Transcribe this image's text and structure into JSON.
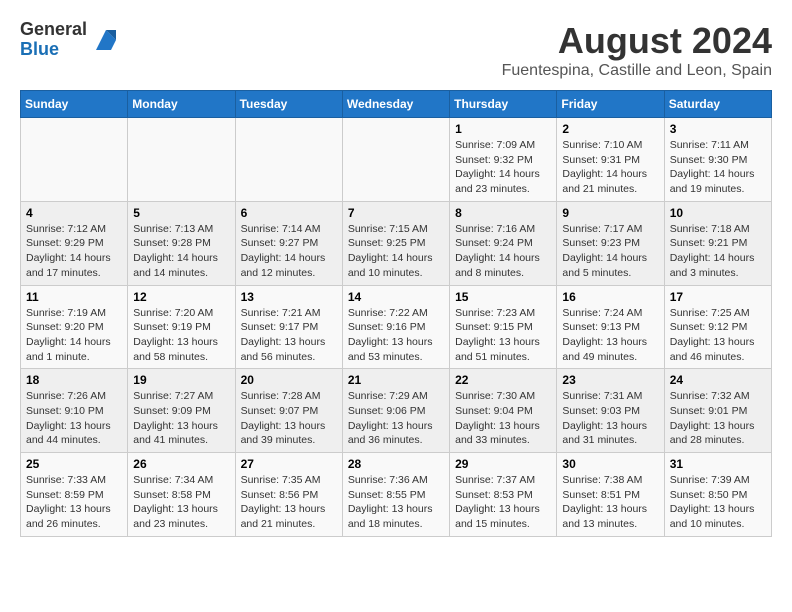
{
  "header": {
    "logo_general": "General",
    "logo_blue": "Blue",
    "month_year": "August 2024",
    "location": "Fuentespina, Castille and Leon, Spain"
  },
  "weekdays": [
    "Sunday",
    "Monday",
    "Tuesday",
    "Wednesday",
    "Thursday",
    "Friday",
    "Saturday"
  ],
  "weeks": [
    [
      {
        "day": "",
        "info": ""
      },
      {
        "day": "",
        "info": ""
      },
      {
        "day": "",
        "info": ""
      },
      {
        "day": "",
        "info": ""
      },
      {
        "day": "1",
        "info": "Sunrise: 7:09 AM\nSunset: 9:32 PM\nDaylight: 14 hours and 23 minutes."
      },
      {
        "day": "2",
        "info": "Sunrise: 7:10 AM\nSunset: 9:31 PM\nDaylight: 14 hours and 21 minutes."
      },
      {
        "day": "3",
        "info": "Sunrise: 7:11 AM\nSunset: 9:30 PM\nDaylight: 14 hours and 19 minutes."
      }
    ],
    [
      {
        "day": "4",
        "info": "Sunrise: 7:12 AM\nSunset: 9:29 PM\nDaylight: 14 hours and 17 minutes."
      },
      {
        "day": "5",
        "info": "Sunrise: 7:13 AM\nSunset: 9:28 PM\nDaylight: 14 hours and 14 minutes."
      },
      {
        "day": "6",
        "info": "Sunrise: 7:14 AM\nSunset: 9:27 PM\nDaylight: 14 hours and 12 minutes."
      },
      {
        "day": "7",
        "info": "Sunrise: 7:15 AM\nSunset: 9:25 PM\nDaylight: 14 hours and 10 minutes."
      },
      {
        "day": "8",
        "info": "Sunrise: 7:16 AM\nSunset: 9:24 PM\nDaylight: 14 hours and 8 minutes."
      },
      {
        "day": "9",
        "info": "Sunrise: 7:17 AM\nSunset: 9:23 PM\nDaylight: 14 hours and 5 minutes."
      },
      {
        "day": "10",
        "info": "Sunrise: 7:18 AM\nSunset: 9:21 PM\nDaylight: 14 hours and 3 minutes."
      }
    ],
    [
      {
        "day": "11",
        "info": "Sunrise: 7:19 AM\nSunset: 9:20 PM\nDaylight: 14 hours and 1 minute."
      },
      {
        "day": "12",
        "info": "Sunrise: 7:20 AM\nSunset: 9:19 PM\nDaylight: 13 hours and 58 minutes."
      },
      {
        "day": "13",
        "info": "Sunrise: 7:21 AM\nSunset: 9:17 PM\nDaylight: 13 hours and 56 minutes."
      },
      {
        "day": "14",
        "info": "Sunrise: 7:22 AM\nSunset: 9:16 PM\nDaylight: 13 hours and 53 minutes."
      },
      {
        "day": "15",
        "info": "Sunrise: 7:23 AM\nSunset: 9:15 PM\nDaylight: 13 hours and 51 minutes."
      },
      {
        "day": "16",
        "info": "Sunrise: 7:24 AM\nSunset: 9:13 PM\nDaylight: 13 hours and 49 minutes."
      },
      {
        "day": "17",
        "info": "Sunrise: 7:25 AM\nSunset: 9:12 PM\nDaylight: 13 hours and 46 minutes."
      }
    ],
    [
      {
        "day": "18",
        "info": "Sunrise: 7:26 AM\nSunset: 9:10 PM\nDaylight: 13 hours and 44 minutes."
      },
      {
        "day": "19",
        "info": "Sunrise: 7:27 AM\nSunset: 9:09 PM\nDaylight: 13 hours and 41 minutes."
      },
      {
        "day": "20",
        "info": "Sunrise: 7:28 AM\nSunset: 9:07 PM\nDaylight: 13 hours and 39 minutes."
      },
      {
        "day": "21",
        "info": "Sunrise: 7:29 AM\nSunset: 9:06 PM\nDaylight: 13 hours and 36 minutes."
      },
      {
        "day": "22",
        "info": "Sunrise: 7:30 AM\nSunset: 9:04 PM\nDaylight: 13 hours and 33 minutes."
      },
      {
        "day": "23",
        "info": "Sunrise: 7:31 AM\nSunset: 9:03 PM\nDaylight: 13 hours and 31 minutes."
      },
      {
        "day": "24",
        "info": "Sunrise: 7:32 AM\nSunset: 9:01 PM\nDaylight: 13 hours and 28 minutes."
      }
    ],
    [
      {
        "day": "25",
        "info": "Sunrise: 7:33 AM\nSunset: 8:59 PM\nDaylight: 13 hours and 26 minutes."
      },
      {
        "day": "26",
        "info": "Sunrise: 7:34 AM\nSunset: 8:58 PM\nDaylight: 13 hours and 23 minutes."
      },
      {
        "day": "27",
        "info": "Sunrise: 7:35 AM\nSunset: 8:56 PM\nDaylight: 13 hours and 21 minutes."
      },
      {
        "day": "28",
        "info": "Sunrise: 7:36 AM\nSunset: 8:55 PM\nDaylight: 13 hours and 18 minutes."
      },
      {
        "day": "29",
        "info": "Sunrise: 7:37 AM\nSunset: 8:53 PM\nDaylight: 13 hours and 15 minutes."
      },
      {
        "day": "30",
        "info": "Sunrise: 7:38 AM\nSunset: 8:51 PM\nDaylight: 13 hours and 13 minutes."
      },
      {
        "day": "31",
        "info": "Sunrise: 7:39 AM\nSunset: 8:50 PM\nDaylight: 13 hours and 10 minutes."
      }
    ]
  ]
}
